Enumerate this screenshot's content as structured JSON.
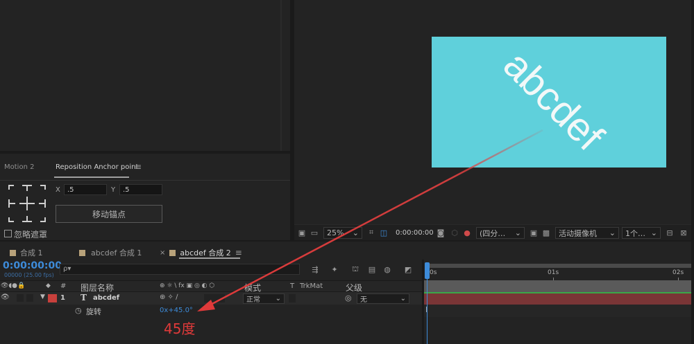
{
  "effects_panel": {
    "tabs": [
      "Motion 2",
      "Reposition Anchor point"
    ],
    "menu_icon": "hamburger-menu-icon",
    "x_label": "X",
    "x_value": ".5",
    "y_label": "Y",
    "y_value": ".5",
    "move_anchor_button": "移动锚点",
    "ignore_mask_label": "忽略遮罩"
  },
  "composition": {
    "text": "abcdef",
    "bg_color": "#5fd0db",
    "text_rotation_deg": 45
  },
  "viewer_toolbar": {
    "zoom": "25%",
    "timecode": "0:00:00:00",
    "resolution": "(四分…",
    "camera": "活动摄像机",
    "views": "1个…"
  },
  "timeline_tabs": [
    {
      "label": "合成 1"
    },
    {
      "label": "abcdef 合成 1"
    },
    {
      "label": "abcdef 合成 2",
      "active": true
    }
  ],
  "timeline": {
    "current_time": "0:00:00:00",
    "frame_info": "00000 (25.00 fps)",
    "search_placeholder": "ρ▾",
    "headers": {
      "hash": "#",
      "layer_name": "图层名称",
      "switches": "⊕ ☼ \\ fx ▣ ◎ ◐ ⬡",
      "mode": "模式",
      "t": "T",
      "trkmat": "TrkMat",
      "parent": "父级"
    },
    "layer": {
      "number": "1",
      "type_icon": "T",
      "name": "abcdef",
      "mode": "正常",
      "parent": "无"
    },
    "property": {
      "name": "旋转",
      "value": "0x+45.0°"
    },
    "ruler": [
      "0s",
      "01s",
      "02s"
    ]
  },
  "annotation": {
    "label": "45度",
    "color": "#e03a3a"
  }
}
